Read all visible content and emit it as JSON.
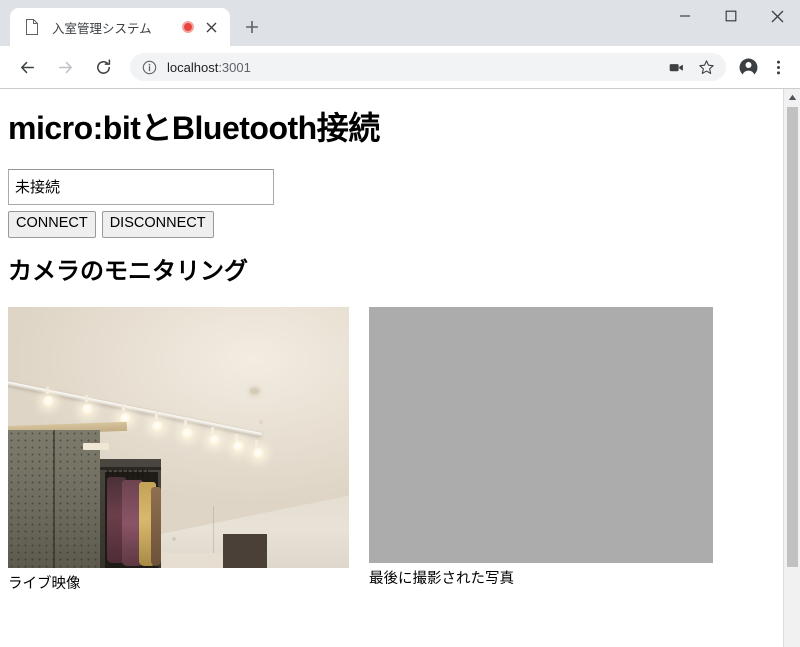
{
  "browser": {
    "tab": {
      "favicon_icon": "page-icon",
      "title": "入室管理システム",
      "media_indicator_icon": "recording-dot-icon",
      "close_icon": "close-icon"
    },
    "new_tab_icon": "plus-icon",
    "window_controls": {
      "minimize_icon": "minimize-icon",
      "maximize_icon": "maximize-icon",
      "close_icon": "close-icon"
    },
    "toolbar": {
      "back_icon": "back-arrow-icon",
      "forward_icon": "forward-arrow-icon",
      "reload_icon": "reload-icon",
      "info_icon": "info-circle-icon",
      "url_host": "localhost",
      "url_port": ":3001",
      "camera_icon": "video-camera-icon",
      "bookmark_icon": "star-icon",
      "profile_icon": "account-avatar-icon",
      "menu_icon": "three-dot-menu-icon"
    },
    "scrollbar": {
      "up_arrow_icon": "scroll-up-arrow-icon"
    }
  },
  "page": {
    "heading": "micro:bitとBluetooth接続",
    "status_field": {
      "value": "未接続",
      "placeholder": ""
    },
    "buttons": {
      "connect": "CONNECT",
      "disconnect": "DISCONNECT"
    },
    "camera_section": {
      "heading": "カメラのモニタリング",
      "live": {
        "caption": "ライブ映像",
        "alt": "room-interior-with-track-lighting-and-clothing-rack"
      },
      "photo": {
        "caption": "最後に撮影された写真",
        "alt": "gray-placeholder"
      }
    }
  },
  "colors": {
    "tabstrip_bg": "#dee1e6",
    "omnibox_bg": "#f1f3f4",
    "recording_red": "#e8453c",
    "button_bg": "#efefef",
    "placeholder_gray": "#acacac",
    "scrollbar_thumb": "#c1c1c1"
  }
}
